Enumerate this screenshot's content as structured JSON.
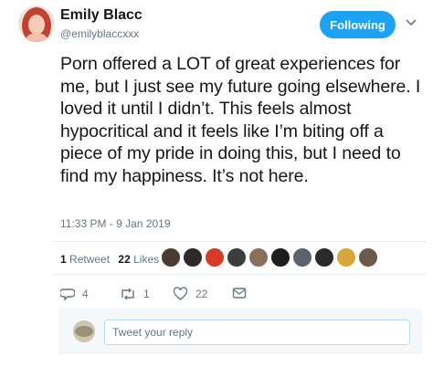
{
  "author": {
    "display_name": "Emily Blacc",
    "handle": "@emilyblaccxxx"
  },
  "header": {
    "follow_label": "Following",
    "caret_icon": "chevron-down-icon"
  },
  "tweet": {
    "text": "Porn offered a LOT of great experiences for me, but I just see my future going elsewhere. I loved it until I didn’t. This feels almost hypocritical and it feels like I’m biting off a piece of my pride in doing this, but I need to find my happiness. It’s not here.",
    "timestamp": "11:33 PM - 9 Jan 2019"
  },
  "stats": {
    "retweet_count": "1",
    "retweet_label": "Retweet",
    "like_count": "22",
    "like_label": "Likes"
  },
  "actions": {
    "reply_count": "4",
    "retweet_count": "1",
    "like_count": "22"
  },
  "reply": {
    "placeholder": "Tweet your reply"
  },
  "colors": {
    "accent": "#1da1f2",
    "text": "#14171a",
    "muted": "#657786",
    "divider": "#e6ecf0"
  }
}
